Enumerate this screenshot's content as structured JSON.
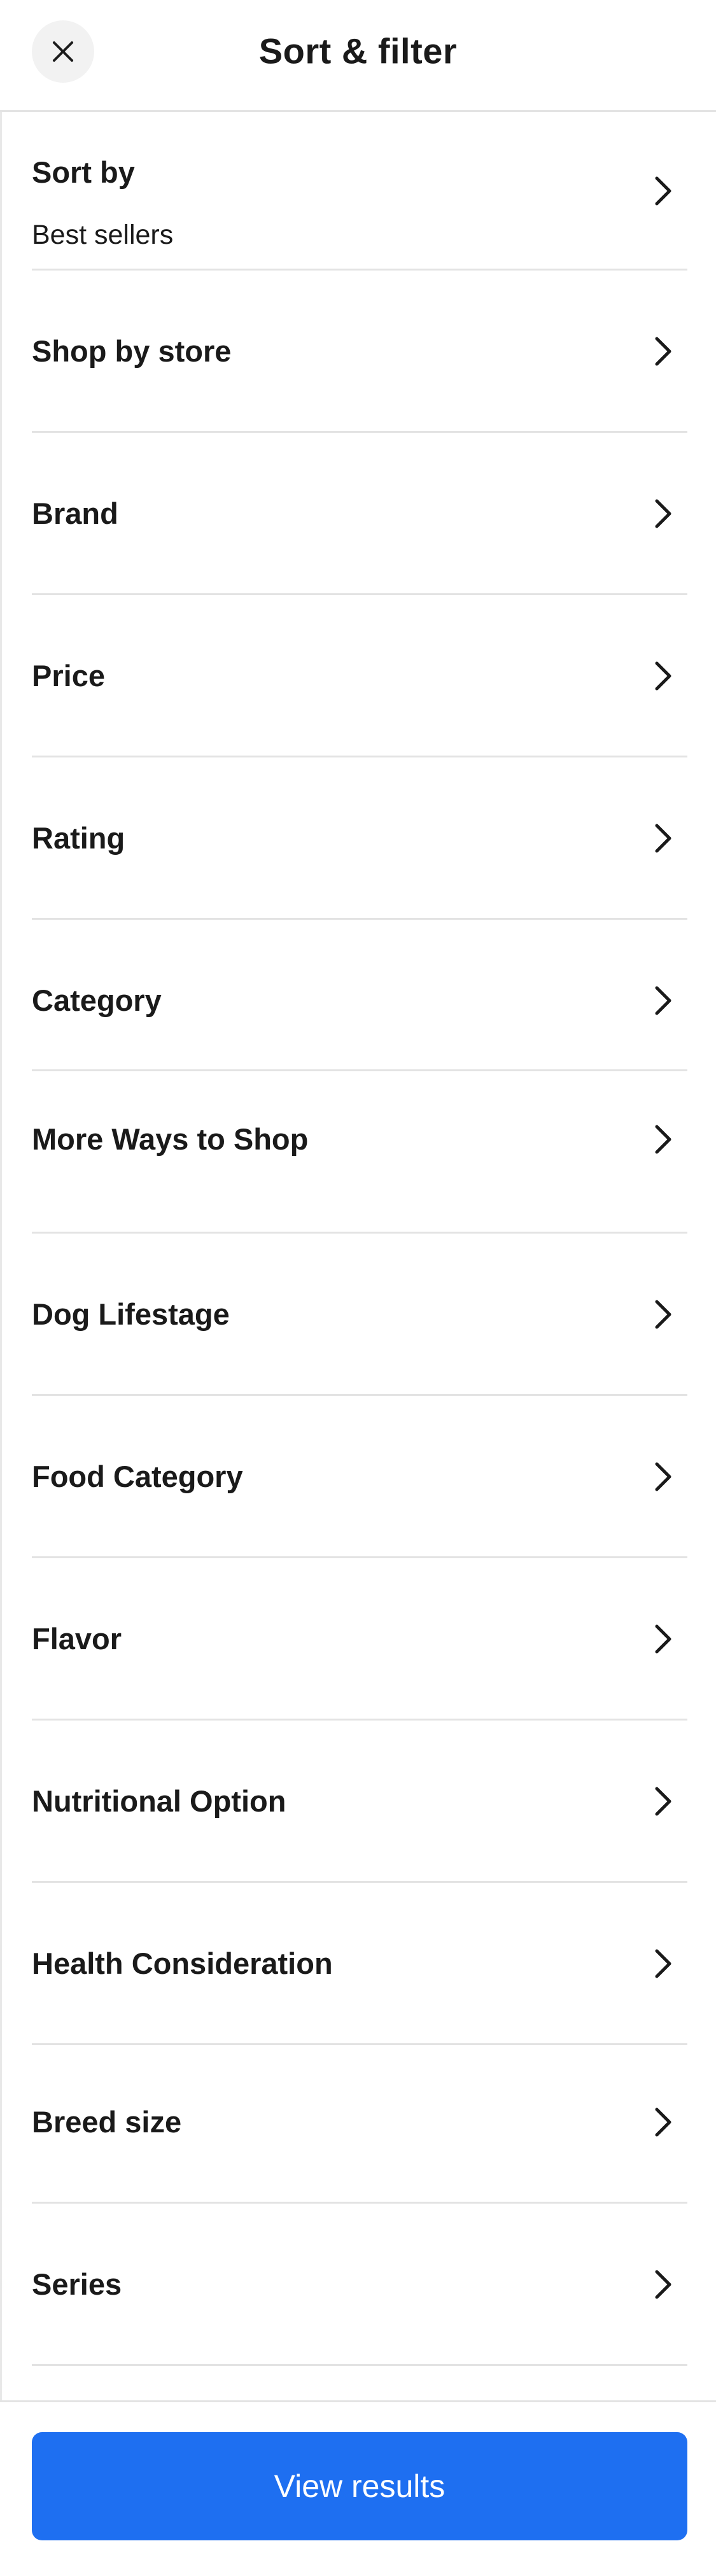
{
  "header": {
    "title": "Sort & filter",
    "close_icon": "close-icon"
  },
  "sort": {
    "label": "Sort by",
    "value": "Best sellers"
  },
  "filters": [
    {
      "label": "Shop by store"
    },
    {
      "label": "Brand"
    },
    {
      "label": "Price"
    },
    {
      "label": "Rating"
    },
    {
      "label": "Category"
    },
    {
      "label": "More Ways to Shop"
    },
    {
      "label": "Dog Lifestage"
    },
    {
      "label": "Food Category"
    },
    {
      "label": "Flavor"
    },
    {
      "label": "Nutritional Option"
    },
    {
      "label": "Health Consideration"
    },
    {
      "label": "Breed size"
    },
    {
      "label": "Series"
    }
  ],
  "footer": {
    "button_label": "View results"
  },
  "colors": {
    "accent": "#1e6ff1",
    "divider": "#e3e3e3",
    "close_bg": "#f2f2f2"
  }
}
